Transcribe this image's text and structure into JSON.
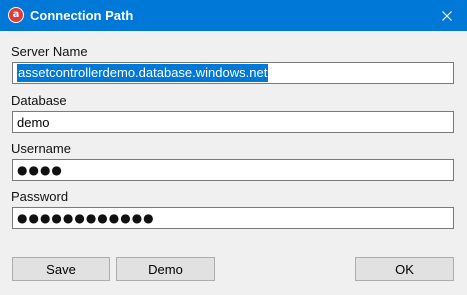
{
  "window": {
    "title": "Connection Path",
    "app_icon_letter": "a",
    "app_icon_color": "#e03a3a",
    "titlebar_color": "#0078d7",
    "close_icon": "close-icon"
  },
  "form": {
    "server_name": {
      "label": "Server Name",
      "value": "assetcontrollerdemo.database.windows.net",
      "selected": true
    },
    "database": {
      "label": "Database",
      "value": "demo"
    },
    "username": {
      "label": "Username",
      "value": "●●●●"
    },
    "password": {
      "label": "Password",
      "value": "●●●●●●●●●●●●"
    }
  },
  "buttons": {
    "save": "Save",
    "demo": "Demo",
    "ok": "OK"
  }
}
